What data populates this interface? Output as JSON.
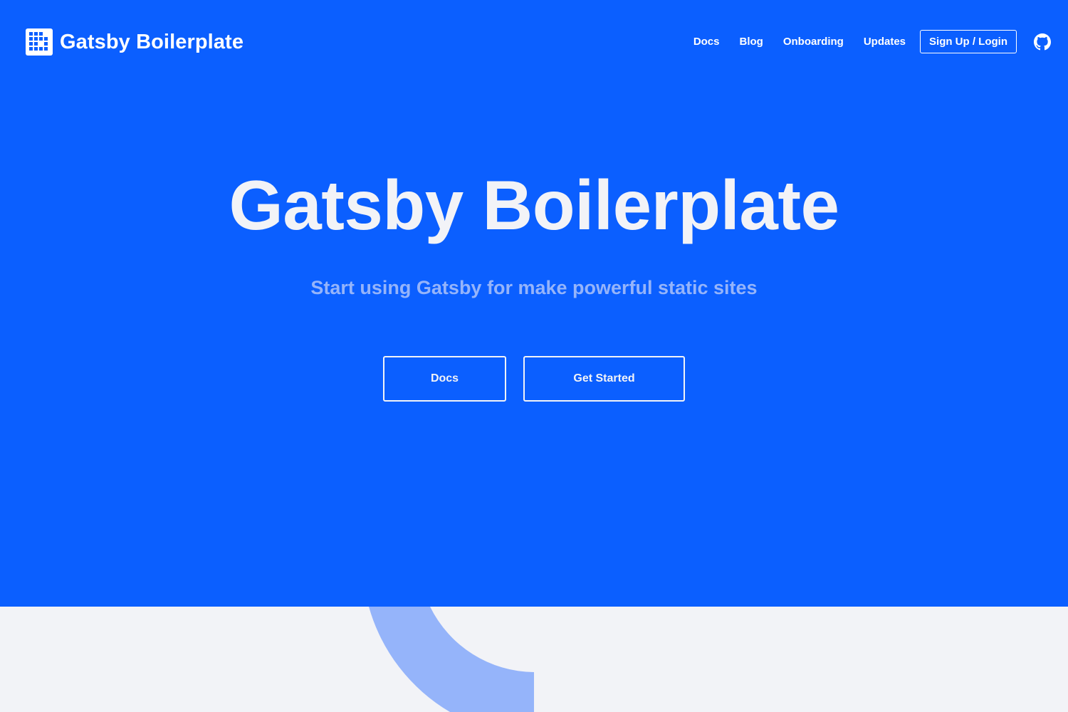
{
  "brand": {
    "name": "Gatsby Boilerplate"
  },
  "nav": {
    "links": [
      {
        "label": "Docs"
      },
      {
        "label": "Blog"
      },
      {
        "label": "Onboarding"
      },
      {
        "label": "Updates"
      }
    ],
    "signup_label": "Sign Up / Login",
    "github_icon": "github-icon"
  },
  "hero": {
    "title": "Gatsby Boilerplate",
    "subtitle": "Start using Gatsby for make powerful static sites",
    "buttons": {
      "docs_label": "Docs",
      "get_started_label": "Get Started"
    }
  },
  "colors": {
    "hero_background": "#0b5fff",
    "text_light": "#f2f3f7",
    "subtitle": "#95b4fa",
    "page_background": "#f2f3f7",
    "accent_shape": "#95b4fa"
  }
}
